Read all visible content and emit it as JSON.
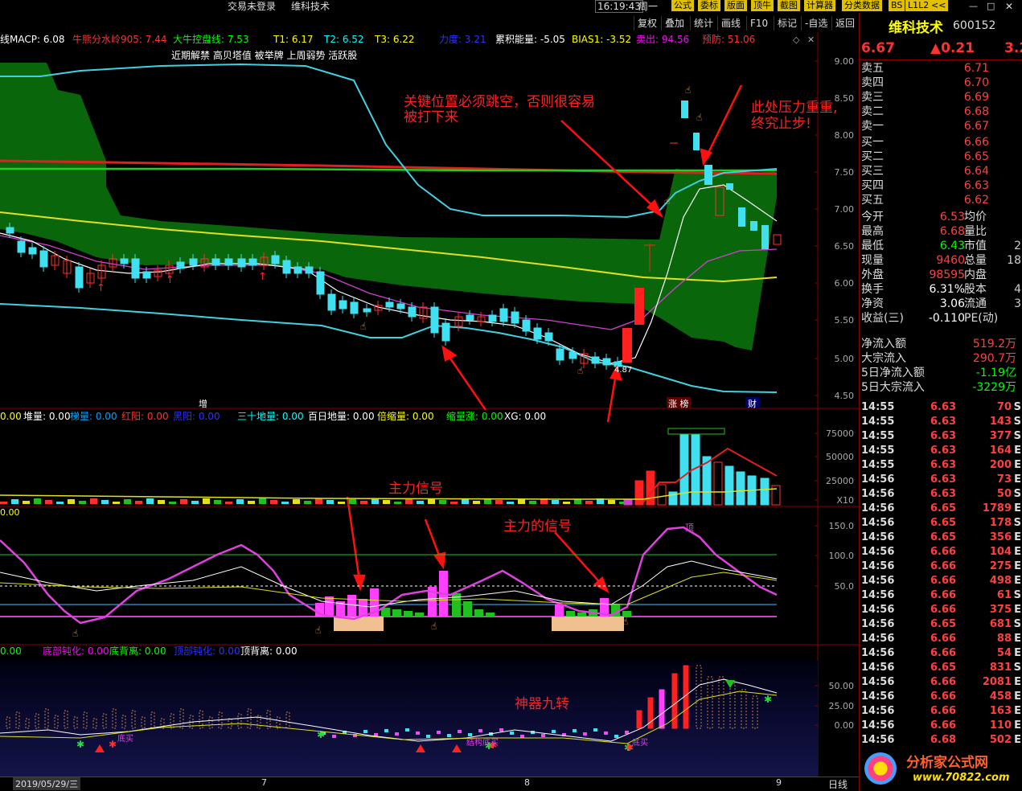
{
  "topbar": {
    "login": "交易未登录",
    "stock_name": "维科技术",
    "time": "16:19:43",
    "weekday": "周一"
  },
  "toolbar": {
    "buttons": [
      "复权",
      "叠加",
      "统计",
      "画线",
      "F10",
      "标记",
      "-自选",
      "返回"
    ],
    "quick": [
      "公式",
      "委标",
      "版面",
      "顶牛",
      "截图",
      "计算器",
      "分类数据",
      "BS",
      "L1L2",
      "<<"
    ]
  },
  "main_panel": {
    "indicators": [
      {
        "text": "线MACP: 6.08",
        "color": "#ffffff"
      },
      {
        "text": "牛熊分水岭905: 7.44",
        "color": "#ff3030"
      },
      {
        "text": "大牛控盘线: 7.53",
        "color": "#00ff00"
      },
      {
        "text": "T1: 6.17",
        "color": "#ffff00"
      },
      {
        "text": "T2: 6.52",
        "color": "#00ffff"
      },
      {
        "text": "T3: 6.22",
        "color": "#ffff00"
      },
      {
        "text": "力度: 3.21",
        "color": "#3030ff"
      },
      {
        "text": "累积能量: -5.05",
        "color": "#ffffff"
      },
      {
        "text": "BIAS1: -3.52",
        "color": "#ffff00"
      },
      {
        "text": "卖出: 94.56",
        "color": "#ff00ff"
      },
      {
        "text": "预防: 51.06",
        "color": "#ff3030"
      }
    ],
    "tags": "近期解禁 高贝塔值 被举牌 上周弱势 活跃股",
    "annotation1": "关键位置必须跳空，否则很容易被打下来",
    "annotation1_l1": "关键位置必须跳空，否则很容易",
    "annotation1_l2": "被打下来",
    "annotation2_l1": "此处压力重重,",
    "annotation2_l2": "终究止步!",
    "low_label": "4.87",
    "markers": {
      "zeng": "增",
      "zhangbang": "涨 榜",
      "cai": "财"
    },
    "y_ticks": [
      "9.00",
      "8.50",
      "8.00",
      "7.50",
      "7.00",
      "6.50",
      "6.00",
      "5.50",
      "5.00",
      "4.50"
    ]
  },
  "volume_panel": {
    "indicators": [
      {
        "text": "堆量: 0.00",
        "color": "#ffffff"
      },
      {
        "text": "梯量: 0.00",
        "color": "#00a0ff"
      },
      {
        "text": "红阳: 0.00",
        "color": "#ff3030"
      },
      {
        "text": "黑阳: 0.00",
        "color": "#3030ff"
      },
      {
        "text": "三十地量: 0.00",
        "color": "#00ffff"
      },
      {
        "text": "百日地量: 0.00",
        "color": "#ffffff"
      },
      {
        "text": "倍缩量: 0.00",
        "color": "#ffff00"
      },
      {
        "text": "缩量涨: 0.00",
        "color": "#00ff00"
      },
      {
        "text": "XG: 0.00",
        "color": "#ffffff"
      }
    ],
    "lead": "0.00",
    "y_ticks": [
      "75000",
      "50000",
      "25000",
      "X10"
    ],
    "annotation": "主力信号"
  },
  "signal_panel": {
    "lead": "0.00",
    "y_ticks": [
      "150.0",
      "100.0",
      "50.0"
    ],
    "annotation": "主力的信号",
    "top_label": "顶"
  },
  "nine_panel": {
    "indicators": [
      {
        "text": "0.00",
        "color": "#00ff00"
      },
      {
        "text": "底部钝化: 0.00",
        "color": "#ff00ff"
      },
      {
        "text": "底背离: 0.00",
        "color": "#00ff00"
      },
      {
        "text": "顶部钝化: 0.00",
        "color": "#3030ff"
      },
      {
        "text": "顶背离: 0.00",
        "color": "#ffffff"
      }
    ],
    "y_ticks": [
      "50.00",
      "25.00",
      "0.00"
    ],
    "annotation": "神器九转",
    "labels": [
      "底买",
      "结构底买",
      "底买"
    ]
  },
  "bottombar": {
    "date": "2019/05/29/三",
    "month_ticks": [
      "7",
      "8",
      "9"
    ],
    "period": "日线"
  },
  "quote": {
    "name": "维科技术",
    "code": "600152",
    "price": "6.67",
    "change": "▲0.21",
    "pct": "3.2",
    "asks": [
      {
        "label": "卖五",
        "price": "6.71"
      },
      {
        "label": "卖四",
        "price": "6.70"
      },
      {
        "label": "卖三",
        "price": "6.69"
      },
      {
        "label": "卖二",
        "price": "6.68"
      },
      {
        "label": "卖一",
        "price": "6.67"
      }
    ],
    "bids": [
      {
        "label": "买一",
        "price": "6.66"
      },
      {
        "label": "买二",
        "price": "6.65"
      },
      {
        "label": "买三",
        "price": "6.64"
      },
      {
        "label": "买四",
        "price": "6.63"
      },
      {
        "label": "买五",
        "price": "6.62"
      }
    ],
    "stats": [
      {
        "l": "今开",
        "v": "6.53",
        "vc": "#ff4040",
        "l2": "均价",
        "v2": ""
      },
      {
        "l": "最高",
        "v": "6.68",
        "vc": "#ff4040",
        "l2": "量比",
        "v2": ""
      },
      {
        "l": "最低",
        "v": "6.43",
        "vc": "#00ff00",
        "l2": "市值",
        "v2": "2"
      },
      {
        "l": "现量",
        "v": "9460",
        "vc": "#ff4040",
        "l2": "总量",
        "v2": "18"
      },
      {
        "l": "外盘",
        "v": "98595",
        "vc": "#ff4040",
        "l2": "内盘",
        "v2": ""
      },
      {
        "l": "换手",
        "v": "6.31%",
        "vc": "#ffffff",
        "l2": "股本",
        "v2": "4"
      },
      {
        "l": "净资",
        "v": "3.06",
        "vc": "#ffffff",
        "l2": "流通",
        "v2": "3"
      },
      {
        "l": "收益(三)",
        "v": "-0.110",
        "vc": "#ffffff",
        "l2": "PE(动)",
        "v2": ""
      }
    ],
    "flows": [
      {
        "l": "净流入额",
        "v": "519.2万",
        "vc": "#ff4040"
      },
      {
        "l": "大宗流入",
        "v": "290.7万",
        "vc": "#ff4040"
      },
      {
        "l": "5日净流入额",
        "v": "-1.19亿",
        "vc": "#00ff00"
      },
      {
        "l": "5日大宗流入",
        "v": "-3229万",
        "vc": "#00ff00"
      }
    ],
    "ticks": [
      {
        "t": "14:55",
        "p": "6.63",
        "q": "70",
        "d": "S"
      },
      {
        "t": "14:55",
        "p": "6.63",
        "q": "143",
        "d": "S"
      },
      {
        "t": "14:55",
        "p": "6.63",
        "q": "377",
        "d": "S"
      },
      {
        "t": "14:55",
        "p": "6.63",
        "q": "164",
        "d": "E"
      },
      {
        "t": "14:55",
        "p": "6.63",
        "q": "200",
        "d": "E"
      },
      {
        "t": "14:56",
        "p": "6.63",
        "q": "73",
        "d": "E"
      },
      {
        "t": "14:56",
        "p": "6.63",
        "q": "50",
        "d": "S"
      },
      {
        "t": "14:56",
        "p": "6.65",
        "q": "1789",
        "d": "E"
      },
      {
        "t": "14:56",
        "p": "6.65",
        "q": "178",
        "d": "S"
      },
      {
        "t": "14:56",
        "p": "6.65",
        "q": "356",
        "d": "E"
      },
      {
        "t": "14:56",
        "p": "6.66",
        "q": "104",
        "d": "E"
      },
      {
        "t": "14:56",
        "p": "6.66",
        "q": "275",
        "d": "E"
      },
      {
        "t": "14:56",
        "p": "6.66",
        "q": "498",
        "d": "E"
      },
      {
        "t": "14:56",
        "p": "6.66",
        "q": "61",
        "d": "S"
      },
      {
        "t": "14:56",
        "p": "6.66",
        "q": "375",
        "d": "E"
      },
      {
        "t": "14:56",
        "p": "6.65",
        "q": "681",
        "d": "S"
      },
      {
        "t": "14:56",
        "p": "6.66",
        "q": "88",
        "d": "E"
      },
      {
        "t": "14:56",
        "p": "6.66",
        "q": "54",
        "d": "E"
      },
      {
        "t": "14:56",
        "p": "6.65",
        "q": "831",
        "d": "S"
      },
      {
        "t": "14:56",
        "p": "6.66",
        "q": "2081",
        "d": "E"
      },
      {
        "t": "14:56",
        "p": "6.66",
        "q": "458",
        "d": "E"
      },
      {
        "t": "14:56",
        "p": "6.66",
        "q": "163",
        "d": "E"
      },
      {
        "t": "14:56",
        "p": "6.66",
        "q": "110",
        "d": "E"
      },
      {
        "t": "14:56",
        "p": "6.68",
        "q": "502",
        "d": "E"
      }
    ]
  },
  "watermark": {
    "name": "分析家公式网",
    "url": "www.70822.com"
  }
}
